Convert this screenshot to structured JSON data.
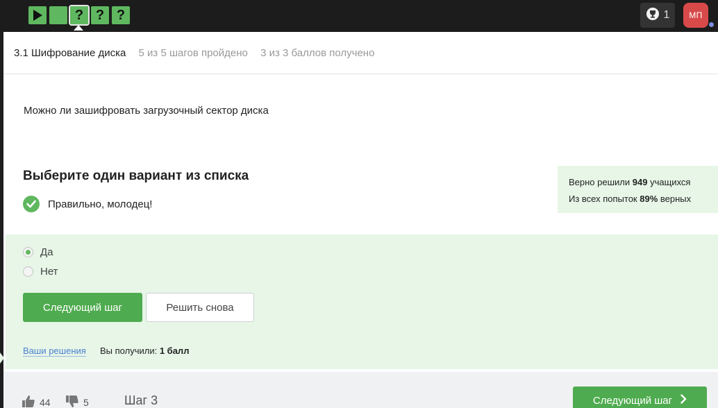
{
  "topbar": {
    "steps": [
      {
        "icon": "play-icon",
        "label": ""
      },
      {
        "icon": "text-step-icon",
        "label": ""
      },
      {
        "icon": "question-icon",
        "label": "?"
      },
      {
        "icon": "question-icon",
        "label": "?"
      },
      {
        "icon": "question-icon",
        "label": "?"
      }
    ],
    "award_count": "1",
    "avatar_initials": "МП"
  },
  "lesson": {
    "title": "3.1 Шифрование диска",
    "steps_progress": "5 из 5 шагов пройдено",
    "points_progress": "3 из 3 баллов  получено"
  },
  "question": {
    "text": "Можно ли зашифровать загрузочный сектор диска",
    "choose_title": "Выберите один вариант из списка",
    "feedback": "Правильно, молодец!"
  },
  "stats": {
    "solved_prefix": "Верно решили",
    "solved_count": "949",
    "solved_suffix": "учащихся",
    "attempts_prefix": "Из всех попыток",
    "attempts_percent": "89%",
    "attempts_suffix": "верных"
  },
  "options": [
    {
      "label": "Да",
      "selected": true
    },
    {
      "label": "Нет",
      "selected": false
    }
  ],
  "actions": {
    "next_label": "Следующий шаг",
    "retry_label": "Решить снова",
    "solutions_link": "Ваши решения",
    "result_prefix": "Вы получили:",
    "result_value": "1 балл"
  },
  "footer": {
    "likes": "44",
    "dislikes": "5",
    "step_label": "Шаг 3",
    "next_label": "Следующий шаг"
  },
  "colors": {
    "accent": "#4fab4f",
    "success_bg": "#e7f6e7",
    "avatar": "#d84a4a",
    "topbar": "#1c1c1c"
  }
}
